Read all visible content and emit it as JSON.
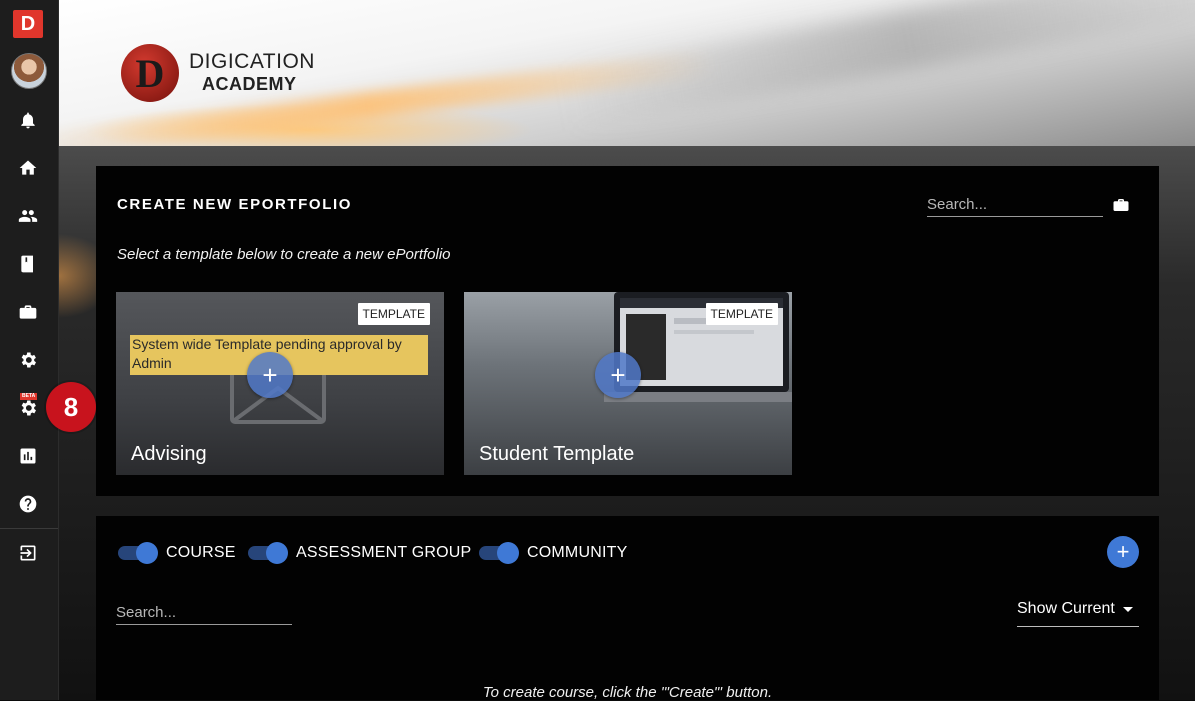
{
  "sidebar": {
    "logo_letter": "D",
    "beta_label": "BETA",
    "step_badge": "8",
    "items": [
      {
        "icon": "bell-icon"
      },
      {
        "icon": "home-icon"
      },
      {
        "icon": "people-icon"
      },
      {
        "icon": "book-icon"
      },
      {
        "icon": "briefcase-icon"
      },
      {
        "icon": "gear-icon"
      },
      {
        "icon": "beta-gear-icon"
      },
      {
        "icon": "chart-icon"
      },
      {
        "icon": "help-icon"
      },
      {
        "icon": "logout-icon"
      }
    ]
  },
  "banner": {
    "brand_letter": "D",
    "brand_line1": "DIGICATION",
    "brand_line2": "ACADEMY"
  },
  "create_panel": {
    "title": "CREATE NEW EPORTFOLIO",
    "search_placeholder": "Search...",
    "subtitle": "Select a template below to create a new ePortfolio",
    "cards": [
      {
        "name": "Advising",
        "tag": "TEMPLATE",
        "notice": "System wide Template pending approval by Admin",
        "add_symbol": "+"
      },
      {
        "name": "Student Template",
        "tag": "TEMPLATE",
        "add_symbol": "+"
      }
    ]
  },
  "groups_panel": {
    "toggles": [
      {
        "label": "COURSE",
        "on": true
      },
      {
        "label": "ASSESSMENT GROUP",
        "on": true
      },
      {
        "label": "COMMUNITY",
        "on": true
      }
    ],
    "add_symbol": "+",
    "search_placeholder": "Search...",
    "filter_value": "Show Current",
    "empty_message": "To create course, click the '\"Create\"' button."
  },
  "colors": {
    "accent_blue": "#3f79d6",
    "brand_red": "#e0362c",
    "notice_yellow": "#e6c55e",
    "badge_red": "#c8131d"
  }
}
